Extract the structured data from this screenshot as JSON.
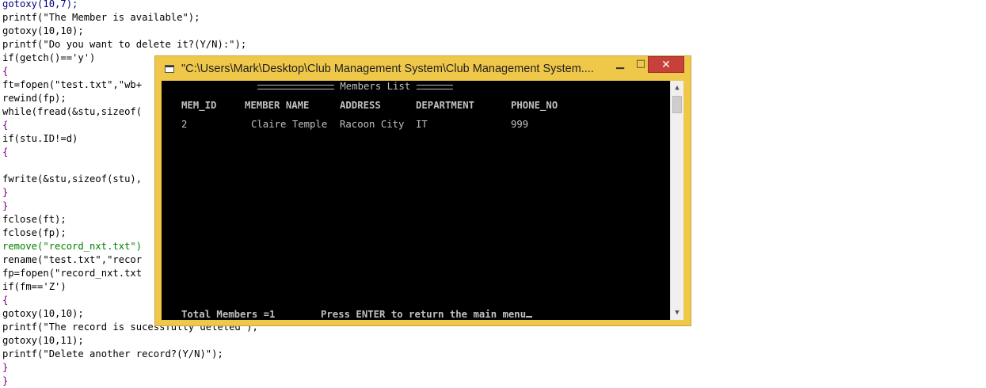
{
  "editor": {
    "lines": [
      "gotoxy(10,7);",
      "printf(\"The Member is available\");",
      "gotoxy(10,10);",
      "printf(\"Do you want to delete it?(Y/N):\");",
      "if(getch()=='y')",
      "{",
      "ft=fopen(\"test.txt\",\"wb+",
      "rewind(fp);",
      "while(fread(&stu,sizeof(",
      "{",
      "if(stu.ID!=d)",
      "{",
      "",
      "fwrite(&stu,sizeof(stu),",
      "}",
      "}",
      "fclose(ft);",
      "fclose(fp);",
      "remove(\"record_nxt.txt\")",
      "rename(\"test.txt\",\"recor",
      "fp=fopen(\"record_nxt.txt",
      "if(fm=='Z')",
      "{",
      "gotoxy(10,10);",
      "printf(\"The record is sucessfully deleted\");",
      "gotoxy(10,11);",
      "printf(\"Delete another record?(Y/N)\");",
      "}",
      "}"
    ]
  },
  "window": {
    "title": "\"C:\\Users\\Mark\\Desktop\\Club Management System\\Club Management System....",
    "minimize_glyph": "▁",
    "maximize_glyph": "□",
    "close_glyph": "✕"
  },
  "console": {
    "header_title": "Members List",
    "columns": [
      "MEM_ID",
      "MEMBER NAME",
      "ADDRESS",
      "DEPARTMENT",
      "PHONE_NO"
    ],
    "rows": [
      {
        "id": "2",
        "name": "Claire Temple",
        "address": "Racoon City",
        "department": "IT",
        "phone": "999"
      }
    ],
    "total_label": "Total Members =1",
    "prompt": "Press ENTER to return the main menu"
  },
  "colors": {
    "titlebar": "#f0c849",
    "close_button": "#c7413a",
    "console_bg": "#000000",
    "console_text": "#c0c0c0"
  }
}
